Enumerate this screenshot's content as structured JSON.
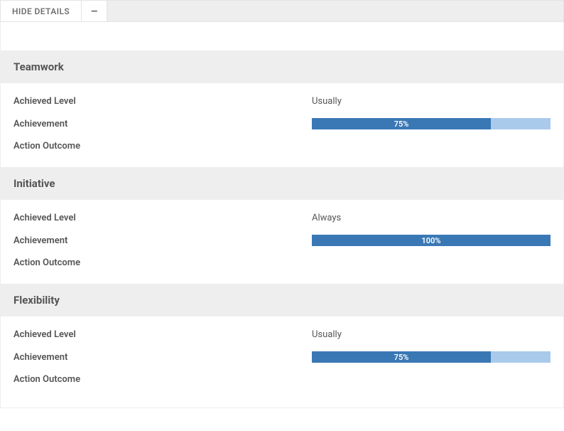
{
  "toolbar": {
    "hide_details_label": "HIDE DETAILS",
    "collapse_symbol": "–"
  },
  "labels": {
    "achieved_level": "Achieved Level",
    "achievement": "Achievement",
    "action_outcome": "Action Outcome"
  },
  "sections": [
    {
      "title": "Teamwork",
      "achieved_level": "Usually",
      "achievement_pct": 75,
      "achievement_text": "75%",
      "action_outcome": ""
    },
    {
      "title": "Initiative",
      "achieved_level": "Always",
      "achievement_pct": 100,
      "achievement_text": "100%",
      "action_outcome": ""
    },
    {
      "title": "Flexibility",
      "achieved_level": "Usually",
      "achievement_pct": 75,
      "achievement_text": "75%",
      "action_outcome": ""
    }
  ],
  "colors": {
    "progress_fill": "#3a78b5",
    "progress_bg": "#a9caeb"
  }
}
